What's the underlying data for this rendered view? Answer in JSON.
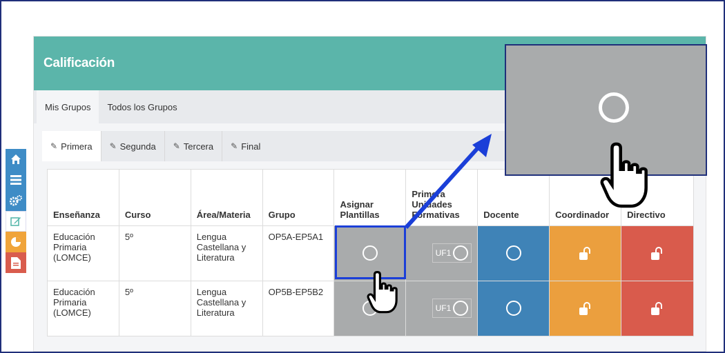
{
  "sidebar": {
    "icons": [
      "home-icon",
      "list-icon",
      "cogs-icon",
      "edit-icon",
      "pie-chart-icon",
      "file-icon"
    ]
  },
  "panel": {
    "title": "Calificación",
    "group_tabs": [
      "Mis Grupos",
      "Todos los Grupos"
    ],
    "eval_tabs": [
      "Primera",
      "Segunda",
      "Tercera",
      "Final"
    ]
  },
  "table": {
    "headers": {
      "ensenanza": "Enseñanza",
      "curso": "Curso",
      "area": "Área/Materia",
      "grupo": "Grupo",
      "asignar": "Asignar Plantillas",
      "primera": "Primera Unidades Formativas",
      "docente": "Docente",
      "coordinador": "Coordinador",
      "directivo": "Directivo"
    },
    "rows": [
      {
        "ensenanza": "Educación Primaria (LOMCE)",
        "curso": "5º",
        "area": "Lengua Castellana y Literatura",
        "grupo": "OP5A-EP5A1",
        "uf": "UF1"
      },
      {
        "ensenanza": "Educación Primaria (LOMCE)",
        "curso": "5º",
        "area": "Lengua Castellana y Literatura",
        "grupo": "OP5B-EP5B2",
        "uf": "UF1"
      }
    ]
  },
  "colors": {
    "header_teal": "#5bb5aa",
    "gray": "#a9abac",
    "blue": "#3f83b7",
    "orange": "#eb9f3e",
    "red": "#d95b4c",
    "highlight": "#1b3fd8"
  }
}
